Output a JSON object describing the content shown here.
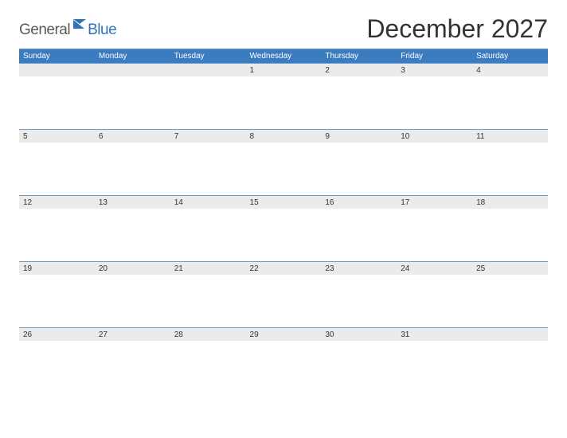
{
  "logo": {
    "text_general": "General",
    "text_blue": "Blue"
  },
  "title": "December 2027",
  "days": [
    "Sunday",
    "Monday",
    "Tuesday",
    "Wednesday",
    "Thursday",
    "Friday",
    "Saturday"
  ],
  "weeks": [
    [
      "",
      "",
      "",
      "1",
      "2",
      "3",
      "4"
    ],
    [
      "5",
      "6",
      "7",
      "8",
      "9",
      "10",
      "11"
    ],
    [
      "12",
      "13",
      "14",
      "15",
      "16",
      "17",
      "18"
    ],
    [
      "19",
      "20",
      "21",
      "22",
      "23",
      "24",
      "25"
    ],
    [
      "26",
      "27",
      "28",
      "29",
      "30",
      "31",
      ""
    ]
  ],
  "colors": {
    "brand_blue": "#3b7bc0",
    "rule_blue": "#6b9dd0",
    "cell_gray": "#ebebeb"
  }
}
